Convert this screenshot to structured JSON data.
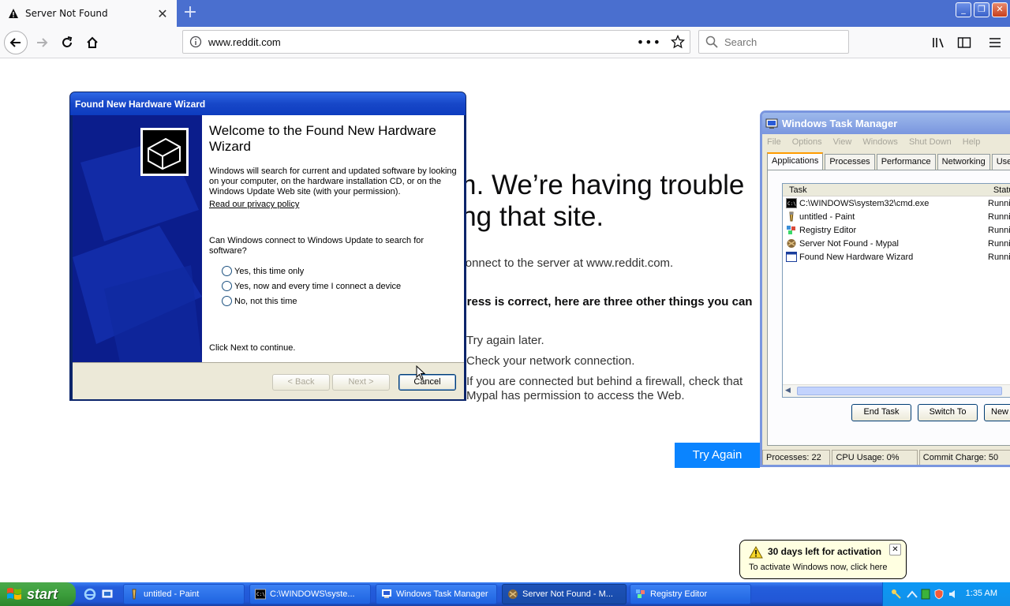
{
  "browser": {
    "tab_title": "Server Not Found",
    "url": "www.reddit.com",
    "search_placeholder": "Search",
    "new_tab_symbol": "+"
  },
  "error_page": {
    "title": "Hmm. We’re having trouble finding that site.",
    "description": "We can’t connect to the server at www.reddit.com.",
    "subheading": "If that address is correct, here are three other things you can try:",
    "tips": [
      "Try again later.",
      "Check your network connection.",
      "If you are connected but behind a firewall, check that Mypal has permission to access the Web."
    ],
    "try_again_label": "Try Again"
  },
  "wizard": {
    "window_title": "Found New Hardware Wizard",
    "heading": "Welcome to the Found New Hardware Wizard",
    "intro": "Windows will search for current and updated software by looking on your computer, on the hardware installation CD, or on the Windows Update Web site (with your permission).",
    "privacy_link": "Read our privacy policy",
    "question": "Can Windows connect to Windows Update to search for software?",
    "options": [
      "Yes, this time only",
      "Yes, now and every time I connect a device",
      "No, not this time"
    ],
    "continue_text": "Click Next to continue.",
    "back_label": "< Back",
    "next_label": "Next >",
    "cancel_label": "Cancel"
  },
  "task_manager": {
    "window_title": "Windows Task Manager",
    "menu": [
      "File",
      "Options",
      "View",
      "Windows",
      "Shut Down",
      "Help"
    ],
    "tabs": [
      "Applications",
      "Processes",
      "Performance",
      "Networking",
      "Users"
    ],
    "columns": [
      "Task",
      "Status"
    ],
    "tasks": [
      {
        "name": "C:\\WINDOWS\\system32\\cmd.exe",
        "status": "Running",
        "icon": "cmd-icon"
      },
      {
        "name": "untitled - Paint",
        "status": "Running",
        "icon": "paint-icon"
      },
      {
        "name": "Registry Editor",
        "status": "Running",
        "icon": "regedit-icon"
      },
      {
        "name": "Server Not Found - Mypal",
        "status": "Running",
        "icon": "mypal-icon"
      },
      {
        "name": "Found New Hardware Wizard",
        "status": "Running",
        "icon": "window-icon"
      }
    ],
    "end_task_label": "End Task",
    "switch_to_label": "Switch To",
    "new_task_label": "New Task...",
    "processes": "Processes: 22",
    "cpu": "CPU Usage: 0%",
    "commit": "Commit Charge: 50"
  },
  "balloon": {
    "title": "30 days left for activation",
    "text": "To activate Windows now, click here"
  },
  "taskbar": {
    "start_label": "start",
    "items": [
      "untitled - Paint",
      "C:\\WINDOWS\\syste...",
      "Windows Task Manager",
      "Server Not Found - M...",
      "Registry Editor"
    ],
    "clock": "1:35 AM"
  }
}
